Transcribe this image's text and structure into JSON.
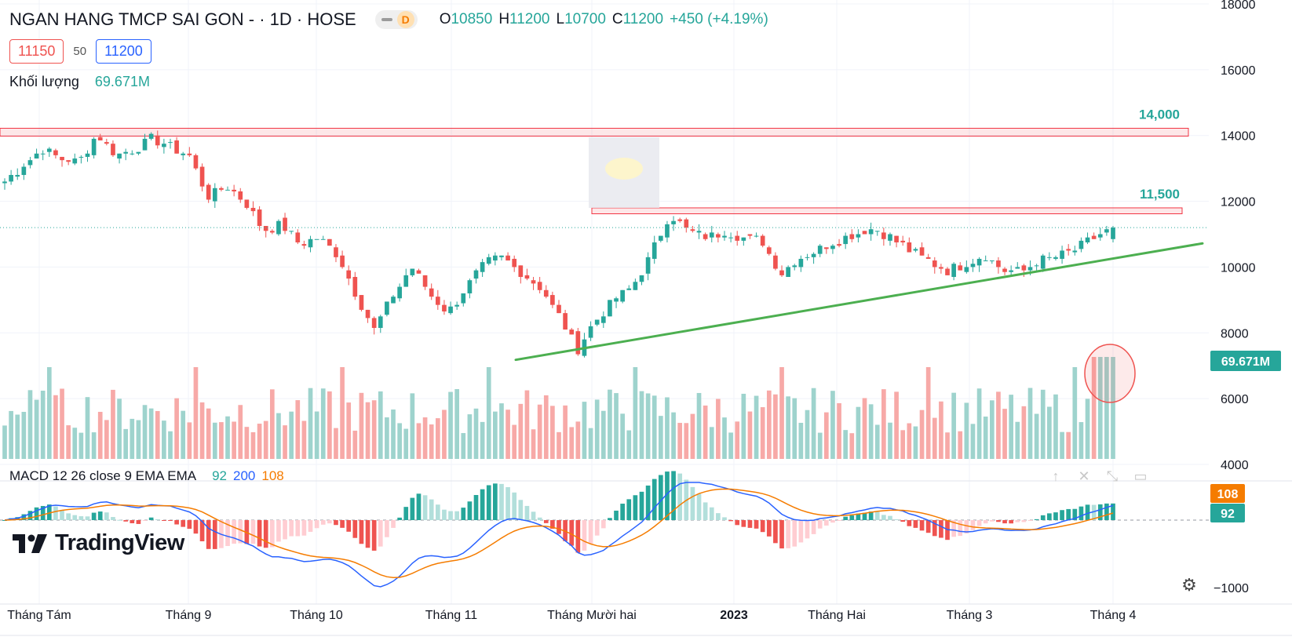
{
  "header": {
    "symbol": "NGAN HANG TMCP SAI GON - · 1D · HOSE",
    "interval_badge": "D",
    "open_label": "O",
    "open": "10850",
    "high_label": "H",
    "high": "11200",
    "low_label": "L",
    "low": "10700",
    "close_label": "C",
    "close": "11200",
    "change": "+450 (+4.19%)",
    "bid": "11150",
    "spread": "50",
    "ask": "11200"
  },
  "volume_legend": {
    "label": "Khối lượng",
    "value": "69.671M"
  },
  "macd_legend": {
    "title": "MACD 12 26 close 9 EMA EMA",
    "v1": "92",
    "v2": "200",
    "v3": "108"
  },
  "brand": "TradingView",
  "icons": [
    "tradingview-logo-icon",
    "arrow-up-icon",
    "close-icon",
    "collapse-icon",
    "maximize-icon",
    "gear-icon"
  ],
  "colors": {
    "up": "#26a69a",
    "down": "#ef5350",
    "macd_line": "#2962ff",
    "signal_line": "#f57c00",
    "trendline": "#4caf50",
    "zone": "#f23645"
  },
  "chart_data": {
    "type": "candlestick",
    "symbol": "NGAN HANG TMCP SAI GON",
    "interval": "1D",
    "exchange": "HOSE",
    "price_axis": {
      "ticks": [
        "18000",
        "16000",
        "14000",
        "12000",
        "10000",
        "8000",
        "6000",
        "4000"
      ],
      "ticks_values": [
        18000,
        16000,
        14000,
        12000,
        10000,
        8000,
        6000,
        4000
      ],
      "range": [
        3700,
        18000
      ]
    },
    "macd_axis": {
      "tick": "−1000",
      "tick_value": -1000,
      "range": [
        -1250,
        650
      ]
    },
    "time_axis": [
      "Tháng Tám",
      "Tháng 9",
      "Tháng 10",
      "Tháng 11",
      "Tháng Mười hai",
      "2023",
      "Tháng Hai",
      "Tháng 3",
      "Tháng 4"
    ],
    "last_price": 11200,
    "last_volume_label": "69.671M",
    "macd_badges": [
      "108",
      "92"
    ],
    "levels": [
      {
        "label": "14,000",
        "price_low": 13980,
        "price_high": 14220
      },
      {
        "label": "11,500",
        "price_low": 11620,
        "price_high": 11800
      }
    ],
    "trendline": {
      "from": {
        "date": "2022-11-16",
        "price": 7180
      },
      "to": {
        "date": "2023-04-12",
        "price": 10720
      }
    },
    "closes_key": [
      12600,
      13100,
      13600,
      13300,
      13200,
      14050,
      13400,
      13550,
      13900,
      13650,
      13400,
      12150,
      12450,
      12000,
      11100,
      11300,
      10700,
      10900,
      10400,
      9200,
      8100,
      9100,
      10000,
      9200,
      8600,
      9400,
      10100,
      10300,
      9800,
      9400,
      8500,
      7500,
      8400,
      9000,
      9400,
      10400,
      11600,
      11100,
      10900,
      11100,
      10900,
      10800,
      9800,
      10300,
      10500,
      10800,
      11000,
      11200,
      10900,
      10500,
      10200,
      9900,
      10100,
      10400,
      9900,
      9850,
      10200,
      10300,
      10550,
      10900,
      11200
    ]
  }
}
